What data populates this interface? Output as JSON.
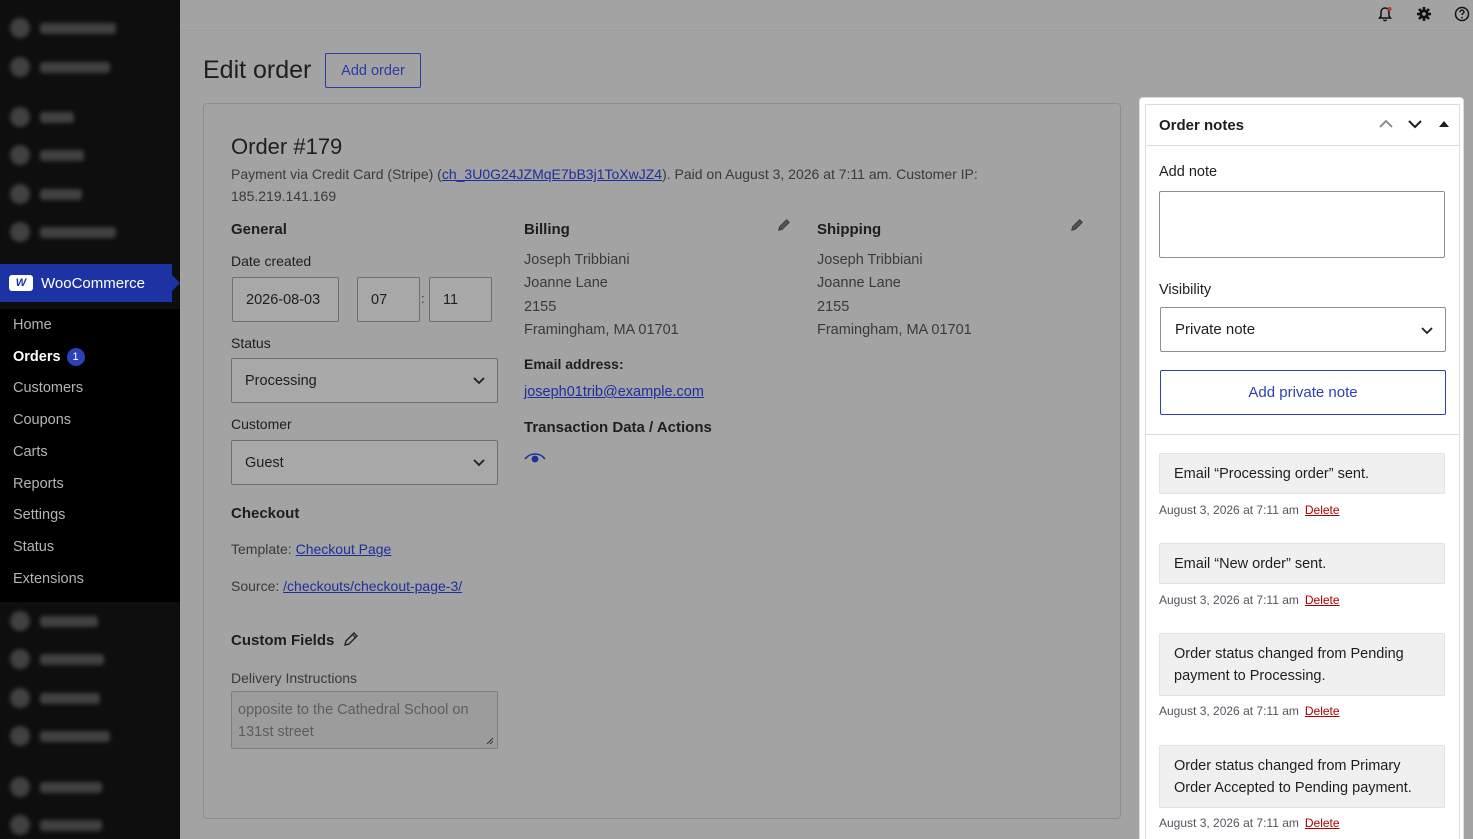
{
  "sidebar": {
    "section_title": "WooCommerce",
    "items": [
      {
        "label": "Home"
      },
      {
        "label": "Orders",
        "badge": "1"
      },
      {
        "label": "Customers"
      },
      {
        "label": "Coupons"
      },
      {
        "label": "Carts"
      },
      {
        "label": "Reports"
      },
      {
        "label": "Settings"
      },
      {
        "label": "Status"
      },
      {
        "label": "Extensions"
      }
    ]
  },
  "topbar": {
    "icons": [
      "bell-alert-icon",
      "gear-icon",
      "help-icon"
    ]
  },
  "header": {
    "title": "Edit order",
    "add_order_label": "Add order"
  },
  "order": {
    "heading": "Order #179",
    "payment_prefix": "Payment via Credit Card (Stripe) (",
    "transaction_id": "ch_3U0G24JZMqE7bB3j1ToXwJZ4",
    "payment_suffix": "). Paid on August 3, 2026 at 7:11 am. Customer IP: 185.219.141.169",
    "general": {
      "title": "General",
      "date_label": "Date created",
      "date_value": "2026-08-03",
      "hour_value": "07",
      "time_sep": ":",
      "minute_value": "11",
      "status_label": "Status",
      "status_value": "Processing",
      "customer_label": "Customer",
      "customer_value": "Guest"
    },
    "billing": {
      "title": "Billing",
      "name": "Joseph Tribbiani",
      "street": "Joanne Lane",
      "number": "2155",
      "city": "Framingham, MA 01701",
      "email_label": "Email address:",
      "email": "joseph01trib@example.com",
      "transaction_title": "Transaction Data / Actions"
    },
    "shipping": {
      "title": "Shipping",
      "name": "Joseph Tribbiani",
      "street": "Joanne Lane",
      "number": "2155",
      "city": "Framingham, MA 01701"
    },
    "checkout": {
      "title": "Checkout",
      "template_label": "Template:",
      "template_value": "Checkout Page",
      "source_label": "Source:",
      "source_value": "/checkouts/checkout-page-3/"
    },
    "custom_fields": {
      "title": "Custom Fields",
      "delivery_label": "Delivery Instructions",
      "delivery_value": "opposite to the Cathedral School on 131st street"
    }
  },
  "notes": {
    "title": "Order notes",
    "add_note_label": "Add note",
    "visibility_label": "Visibility",
    "visibility_value": "Private note",
    "add_button_label": "Add private note",
    "delete_label": "Delete",
    "items": [
      {
        "text": "Email “Processing order” sent.",
        "date": "August 3, 2026 at 7:11 am"
      },
      {
        "text": "Email “New order” sent.",
        "date": "August 3, 2026 at 7:11 am"
      },
      {
        "text": "Order status changed from Pending payment to Processing.",
        "date": "August 3, 2026 at 7:11 am"
      },
      {
        "text": "Order status changed from Primary Order Accepted to Pending payment.",
        "date": "August 3, 2026 at 7:11 am"
      }
    ]
  }
}
